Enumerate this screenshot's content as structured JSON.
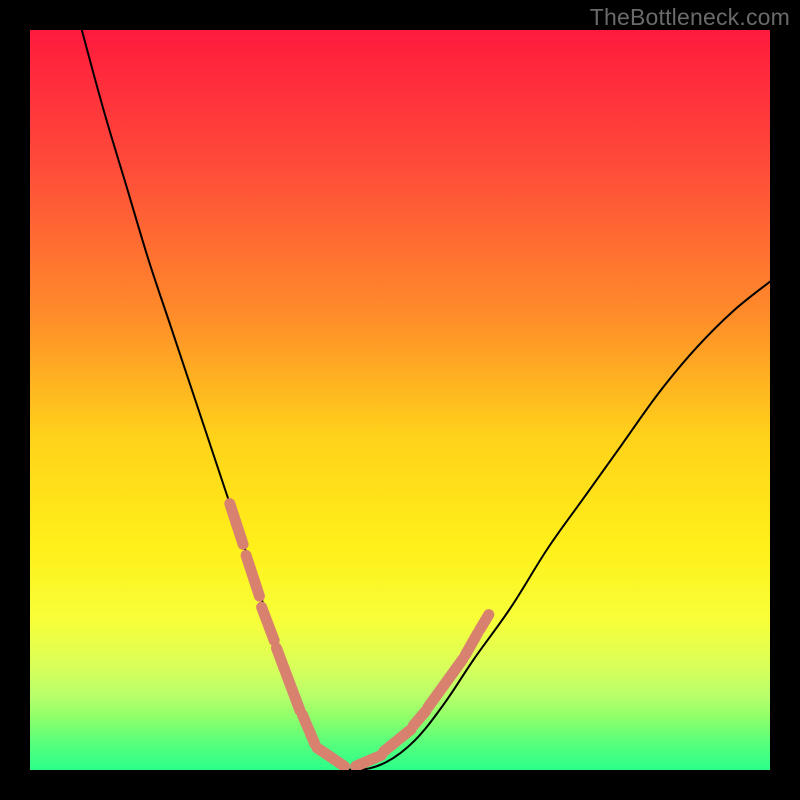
{
  "watermark": "TheBottleneck.com",
  "chart_data": {
    "type": "line",
    "title": "",
    "xlabel": "",
    "ylabel": "",
    "xlim": [
      0,
      100
    ],
    "ylim": [
      0,
      100
    ],
    "grid": false,
    "legend": false,
    "gradient_stops": [
      {
        "offset": 0.0,
        "color": "#ff1a3d"
      },
      {
        "offset": 0.18,
        "color": "#ff4a3a"
      },
      {
        "offset": 0.38,
        "color": "#ff8a2a"
      },
      {
        "offset": 0.55,
        "color": "#ffd21a"
      },
      {
        "offset": 0.7,
        "color": "#fff01a"
      },
      {
        "offset": 0.8,
        "color": "#f7ff3a"
      },
      {
        "offset": 0.86,
        "color": "#d9ff5a"
      },
      {
        "offset": 0.9,
        "color": "#b7ff6a"
      },
      {
        "offset": 0.93,
        "color": "#8dff6a"
      },
      {
        "offset": 0.96,
        "color": "#5dff7a"
      },
      {
        "offset": 1.0,
        "color": "#2bff8a"
      }
    ],
    "series": [
      {
        "name": "bottleneck-curve",
        "color": "#000000",
        "stroke_width": 2,
        "x": [
          7,
          10,
          13,
          16,
          19,
          22,
          25,
          27,
          29,
          31,
          33,
          35,
          37,
          39,
          41,
          44,
          48,
          52,
          56,
          60,
          65,
          70,
          75,
          80,
          85,
          90,
          95,
          100
        ],
        "y": [
          100,
          89,
          79,
          69,
          60,
          51,
          42,
          36,
          30,
          24,
          18,
          12,
          7,
          3,
          1,
          0,
          1,
          4,
          9,
          15,
          22,
          30,
          37,
          44,
          51,
          57,
          62,
          66
        ]
      },
      {
        "name": "highlight-left",
        "color": "#d9816f",
        "stroke_width": 11,
        "segments": [
          {
            "x": [
              27.0,
              28.8
            ],
            "y": [
              36.0,
              30.5
            ]
          },
          {
            "x": [
              29.2,
              31.0
            ],
            "y": [
              29.0,
              23.5
            ]
          },
          {
            "x": [
              31.3,
              33.0
            ],
            "y": [
              22.0,
              17.5
            ]
          },
          {
            "x": [
              33.3,
              36.5
            ],
            "y": [
              16.5,
              8.0
            ]
          },
          {
            "x": [
              36.8,
              38.5
            ],
            "y": [
              7.5,
              3.5
            ]
          },
          {
            "x": [
              38.8,
              42.5
            ],
            "y": [
              3.0,
              0.5
            ]
          }
        ]
      },
      {
        "name": "highlight-right",
        "color": "#d9816f",
        "stroke_width": 11,
        "segments": [
          {
            "x": [
              44.0,
              47.5
            ],
            "y": [
              0.5,
              2.0
            ]
          },
          {
            "x": [
              47.8,
              51.5
            ],
            "y": [
              2.5,
              5.5
            ]
          },
          {
            "x": [
              51.8,
              53.5
            ],
            "y": [
              6.0,
              8.0
            ]
          },
          {
            "x": [
              53.8,
              58.5
            ],
            "y": [
              8.5,
              15.0
            ]
          },
          {
            "x": [
              58.8,
              60.5
            ],
            "y": [
              15.5,
              18.5
            ]
          },
          {
            "x": [
              60.8,
              62.0
            ],
            "y": [
              19.0,
              21.0
            ]
          }
        ]
      }
    ]
  }
}
